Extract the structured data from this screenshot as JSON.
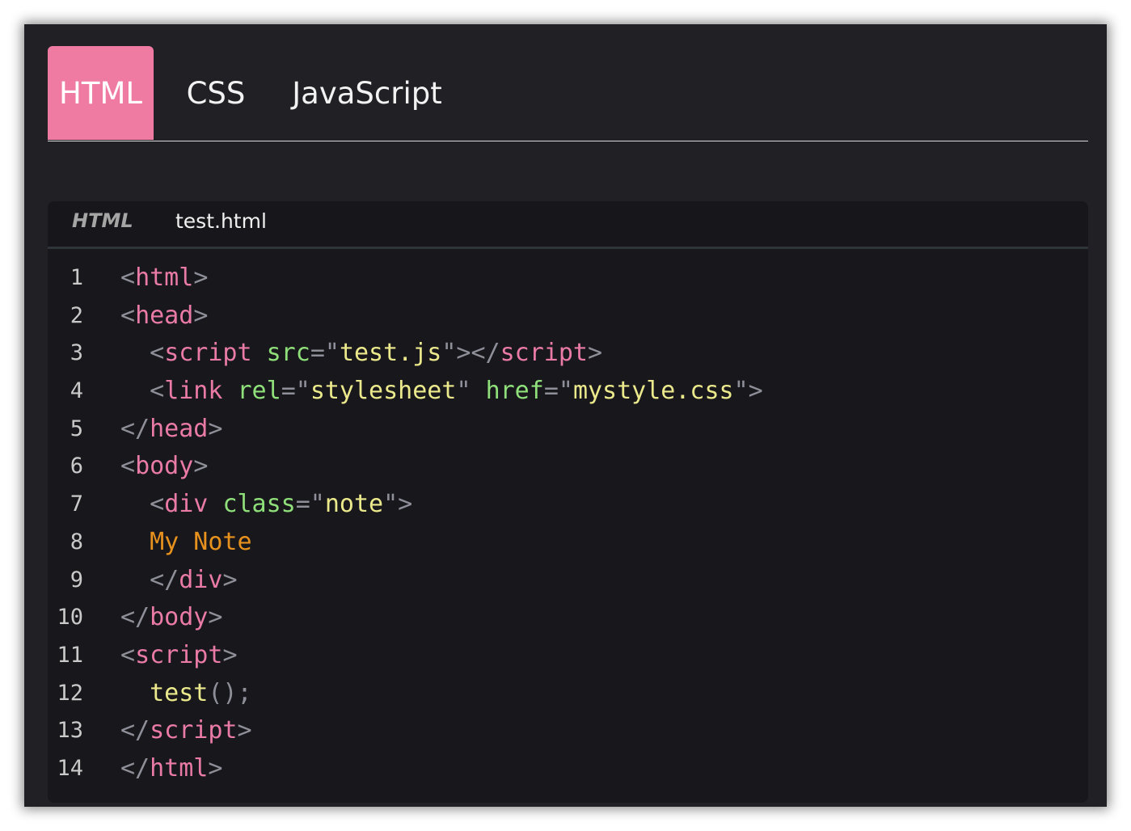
{
  "tabs": [
    {
      "label": "HTML",
      "active": true
    },
    {
      "label": "CSS",
      "active": false
    },
    {
      "label": "JavaScript",
      "active": false
    }
  ],
  "panel": {
    "language": "HTML",
    "file_name": "test.html"
  },
  "colors": {
    "active_tab": "#ef7aa2",
    "background": "#202025",
    "code_background": "#18181c",
    "tag": "#ea7aa6",
    "attribute": "#8fe07a",
    "string": "#ebe98c",
    "text": "#e8921e",
    "punctuation": "#8f8f9a"
  },
  "code_lines": [
    {
      "number": "1",
      "tokens": [
        [
          "p",
          "<"
        ],
        [
          "t",
          "html"
        ],
        [
          "p",
          ">"
        ]
      ]
    },
    {
      "number": "2",
      "tokens": [
        [
          "p",
          "<"
        ],
        [
          "t",
          "head"
        ],
        [
          "p",
          ">"
        ]
      ]
    },
    {
      "number": "3",
      "tokens": [
        [
          "p",
          "  <"
        ],
        [
          "t",
          "script"
        ],
        [
          "p",
          " "
        ],
        [
          "a",
          "src"
        ],
        [
          "p",
          "=\""
        ],
        [
          "s",
          "test.js"
        ],
        [
          "p",
          "\"></"
        ],
        [
          "t",
          "script"
        ],
        [
          "p",
          ">"
        ]
      ]
    },
    {
      "number": "4",
      "tokens": [
        [
          "p",
          "  <"
        ],
        [
          "t",
          "link"
        ],
        [
          "p",
          " "
        ],
        [
          "a",
          "rel"
        ],
        [
          "p",
          "=\""
        ],
        [
          "s",
          "stylesheet"
        ],
        [
          "p",
          "\" "
        ],
        [
          "a",
          "href"
        ],
        [
          "p",
          "=\""
        ],
        [
          "s",
          "mystyle.css"
        ],
        [
          "p",
          "\">"
        ]
      ]
    },
    {
      "number": "5",
      "tokens": [
        [
          "p",
          "</"
        ],
        [
          "t",
          "head"
        ],
        [
          "p",
          ">"
        ]
      ]
    },
    {
      "number": "6",
      "tokens": [
        [
          "p",
          "<"
        ],
        [
          "t",
          "body"
        ],
        [
          "p",
          ">"
        ]
      ]
    },
    {
      "number": "7",
      "tokens": [
        [
          "p",
          "  <"
        ],
        [
          "t",
          "div"
        ],
        [
          "p",
          " "
        ],
        [
          "a",
          "class"
        ],
        [
          "p",
          "=\""
        ],
        [
          "s",
          "note"
        ],
        [
          "p",
          "\">"
        ]
      ]
    },
    {
      "number": "8",
      "tokens": [
        [
          "x",
          "  My Note"
        ]
      ]
    },
    {
      "number": "9",
      "tokens": [
        [
          "p",
          "  </"
        ],
        [
          "t",
          "div"
        ],
        [
          "p",
          ">"
        ]
      ]
    },
    {
      "number": "10",
      "tokens": [
        [
          "p",
          "</"
        ],
        [
          "t",
          "body"
        ],
        [
          "p",
          ">"
        ]
      ]
    },
    {
      "number": "11",
      "tokens": [
        [
          "p",
          "<"
        ],
        [
          "t",
          "script"
        ],
        [
          "p",
          ">"
        ]
      ]
    },
    {
      "number": "12",
      "tokens": [
        [
          "s",
          "  test"
        ],
        [
          "p",
          "();"
        ]
      ]
    },
    {
      "number": "13",
      "tokens": [
        [
          "p",
          "</"
        ],
        [
          "t",
          "script"
        ],
        [
          "p",
          ">"
        ]
      ]
    },
    {
      "number": "14",
      "tokens": [
        [
          "p",
          "</"
        ],
        [
          "t",
          "html"
        ],
        [
          "p",
          ">"
        ]
      ]
    }
  ]
}
